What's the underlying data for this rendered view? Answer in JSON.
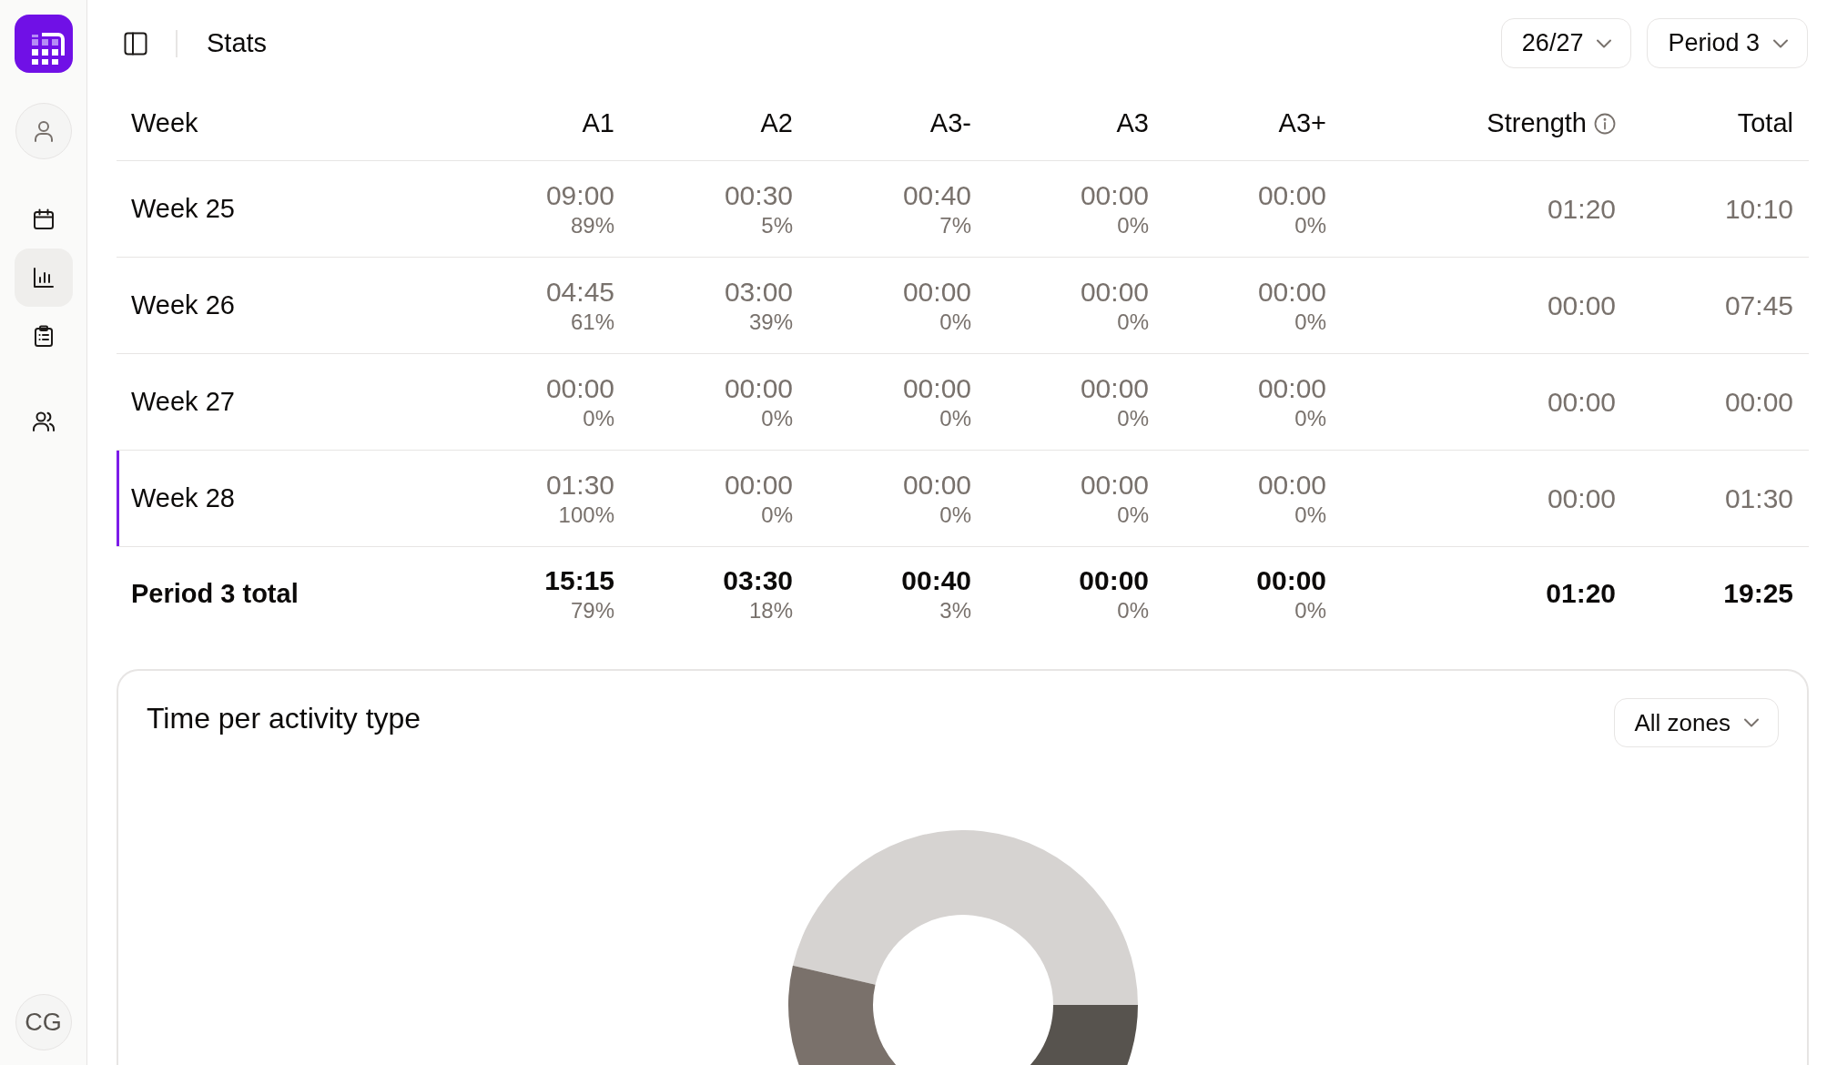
{
  "sidebar": {
    "nav_groups": [
      {
        "items": [
          {
            "selected": false
          },
          {
            "selected": true
          },
          {
            "selected": false
          }
        ]
      },
      {
        "items": [
          {
            "selected": false
          }
        ]
      }
    ],
    "avatar": {
      "initials": "CG"
    }
  },
  "topbar": {
    "title": "Stats",
    "selectors": [
      {
        "value": "26/27"
      },
      {
        "value": "Period 3"
      }
    ]
  },
  "table": {
    "columns": [
      {
        "label": "Week",
        "info": false
      },
      {
        "label": "A1",
        "info": false
      },
      {
        "label": "A2",
        "info": false
      },
      {
        "label": "A3-",
        "info": false
      },
      {
        "label": "A3",
        "info": false
      },
      {
        "label": "A3+",
        "info": false
      },
      {
        "label": "Strength",
        "info": true
      },
      {
        "label": "Total",
        "info": false
      }
    ],
    "rows": [
      {
        "week": "Week 25",
        "current": false,
        "zones": [
          {
            "time": "09:00",
            "share": "89%"
          },
          {
            "time": "00:30",
            "share": "5%"
          },
          {
            "time": "00:40",
            "share": "7%"
          },
          {
            "time": "00:00",
            "share": "0%"
          },
          {
            "time": "00:00",
            "share": "0%"
          }
        ],
        "strength": "01:20",
        "total": "10:10"
      },
      {
        "week": "Week 26",
        "current": false,
        "zones": [
          {
            "time": "04:45",
            "share": "61%"
          },
          {
            "time": "03:00",
            "share": "39%"
          },
          {
            "time": "00:00",
            "share": "0%"
          },
          {
            "time": "00:00",
            "share": "0%"
          },
          {
            "time": "00:00",
            "share": "0%"
          }
        ],
        "strength": "00:00",
        "total": "07:45"
      },
      {
        "week": "Week 27",
        "current": false,
        "zones": [
          {
            "time": "00:00",
            "share": "0%"
          },
          {
            "time": "00:00",
            "share": "0%"
          },
          {
            "time": "00:00",
            "share": "0%"
          },
          {
            "time": "00:00",
            "share": "0%"
          },
          {
            "time": "00:00",
            "share": "0%"
          }
        ],
        "strength": "00:00",
        "total": "00:00"
      },
      {
        "week": "Week 28",
        "current": true,
        "zones": [
          {
            "time": "01:30",
            "share": "100%"
          },
          {
            "time": "00:00",
            "share": "0%"
          },
          {
            "time": "00:00",
            "share": "0%"
          },
          {
            "time": "00:00",
            "share": "0%"
          },
          {
            "time": "00:00",
            "share": "0%"
          }
        ],
        "strength": "00:00",
        "total": "01:30"
      }
    ],
    "total_row": {
      "label": "Period 3 total",
      "zones": [
        {
          "time": "15:15",
          "share": "79%"
        },
        {
          "time": "03:30",
          "share": "18%"
        },
        {
          "time": "00:40",
          "share": "3%"
        },
        {
          "time": "00:00",
          "share": "0%"
        },
        {
          "time": "00:00",
          "share": "0%"
        }
      ],
      "strength": "01:20",
      "total": "19:25"
    }
  },
  "activity_card": {
    "title": "Time per activity type",
    "filter": {
      "value": "All zones"
    }
  }
}
